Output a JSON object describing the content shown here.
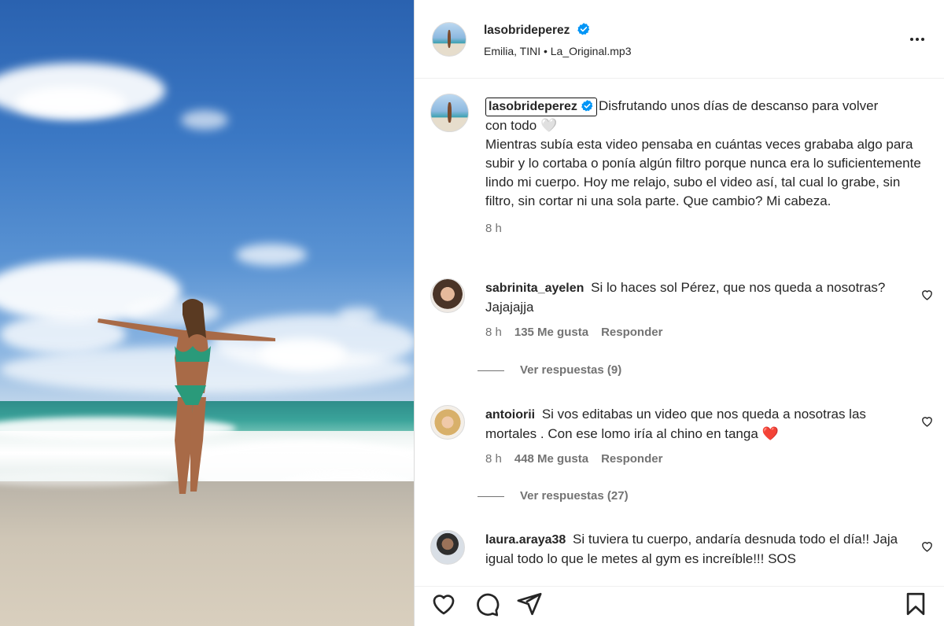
{
  "post": {
    "media_alt": "beach-photo",
    "author": {
      "username": "lasobrideperez",
      "verified": true,
      "audio": "Emilia, TINI • La_Original.mp3"
    },
    "caption": {
      "username": "lasobrideperez",
      "text_line1": "Disfrutando unos días de descanso para volver",
      "text_line2": "con todo 🤍",
      "paragraph": "Mientras subía esta video pensaba en cuántas veces grababa algo para subir y lo cortaba o ponía algún filtro porque nunca era lo suficientemente lindo mi cuerpo. Hoy me relajo, subo el video así, tal cual lo grabe, sin filtro, sin cortar ni una sola parte. Que cambio? Mi cabeza.",
      "time": "8 h"
    },
    "comments": [
      {
        "username": "sabrinita_ayelen",
        "text": "Si lo haces sol Pérez, que nos queda a nosotras? Jajajajja",
        "time": "8 h",
        "likes": "135 Me gusta",
        "reply_label": "Responder",
        "view_replies": "Ver respuestas (9)"
      },
      {
        "username": "antoiorii",
        "text": "Si vos editabas un video que nos queda a nosotras las mortales . Con ese lomo iría al chino en tanga ❤️",
        "time": "8 h",
        "likes": "448 Me gusta",
        "reply_label": "Responder",
        "view_replies": "Ver respuestas (27)"
      },
      {
        "username": "laura.araya38",
        "text": "Si tuviera tu cuerpo, andaría desnuda todo el día!! Jaja igual todo lo que le metes al gym es increíble!!! SOS"
      }
    ],
    "actions": {
      "like": "heart-icon",
      "comment": "comment-icon",
      "share": "share-icon",
      "save": "bookmark-icon"
    }
  },
  "colors": {
    "verified_blue": "#0095f6",
    "text": "#262626",
    "secondary": "#737373",
    "heart_red": "#e0245e"
  }
}
